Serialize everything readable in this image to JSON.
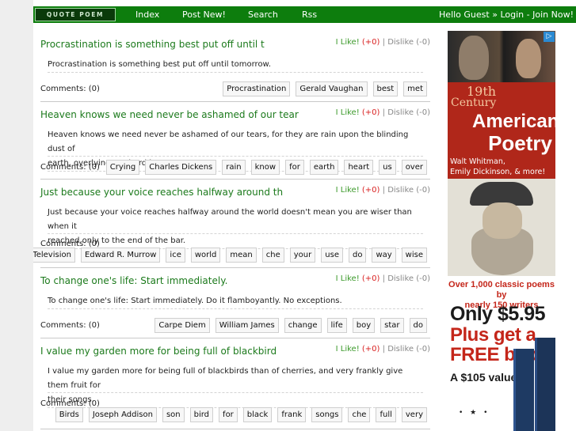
{
  "header": {
    "logo": "QUOTE POEM",
    "nav": [
      {
        "label": "Index"
      },
      {
        "label": "Post New!"
      },
      {
        "label": "Search"
      },
      {
        "label": "Rss"
      }
    ],
    "greeting": "Hello Guest »",
    "login": "Login",
    "separator": "-",
    "join": "Join Now!"
  },
  "vote": {
    "like": "I Like!",
    "like_count": "(+0)",
    "sep": "|",
    "dislike": "Dislike (-0)"
  },
  "posts": [
    {
      "title": "Procrastination is something best put off until t",
      "lines": [
        "Procrastination is something best put off until tomorrow."
      ],
      "comments": "Comments: (0)",
      "tags": [
        "Procrastination",
        "Gerald Vaughan",
        "best",
        "met"
      ]
    },
    {
      "title": "Heaven knows we need never be ashamed of our tear",
      "lines": [
        "Heaven knows we need never be ashamed of our tears, for they are rain upon the blinding dust of",
        "earth, overlying our hard hearts."
      ],
      "comments": "Comments: (0)",
      "tags": [
        "Crying",
        "Charles Dickens",
        "rain",
        "know",
        "for",
        "earth",
        "heart",
        "us",
        "over"
      ]
    },
    {
      "title": "Just because your voice reaches halfway around th",
      "lines": [
        "Just because your voice reaches halfway around the world doesn't mean you are wiser than when it",
        "reached only to the end of the bar."
      ],
      "comments": "Comments: (0)",
      "tags": [
        "Television",
        "Edward R. Murrow",
        "ice",
        "world",
        "mean",
        "che",
        "your",
        "use",
        "do",
        "way",
        "wise"
      ]
    },
    {
      "title": "To change one's life: Start immediately.",
      "lines": [
        "To change one's life: Start immediately. Do it flamboyantly. No exceptions."
      ],
      "comments": "Comments: (0)",
      "tags": [
        "Carpe Diem",
        "William James",
        "change",
        "life",
        "boy",
        "star",
        "do"
      ]
    },
    {
      "title": "I value my garden more for being full of blackbird",
      "lines": [
        "I value my garden more for being full of blackbirds than of cherries, and very frankly give them fruit for",
        "their songs."
      ],
      "comments": "Comments: (0)",
      "tags": [
        "Birds",
        "Joseph Addison",
        "son",
        "bird",
        "for",
        "black",
        "frank",
        "songs",
        "che",
        "full",
        "very"
      ]
    }
  ],
  "ad": {
    "century": "19th",
    "century2": "Century",
    "line1": "American",
    "line2": "Poetry",
    "sub1": "Walt Whitman,",
    "sub2": "Emily Dickinson, & more!",
    "promo1": "Over 1,000 classic poems by",
    "promo2": "nearly 150 writers",
    "price": "Only $5.95",
    "plus1": "Plus get a",
    "plus2": "FREE book!",
    "value": "A $105 value",
    "close": "▷"
  },
  "colors": {
    "nav_bg": "#0d7d0d",
    "title_green": "#1c7a1c",
    "like_green": "#3c9a2b",
    "count_red": "#d92020"
  }
}
